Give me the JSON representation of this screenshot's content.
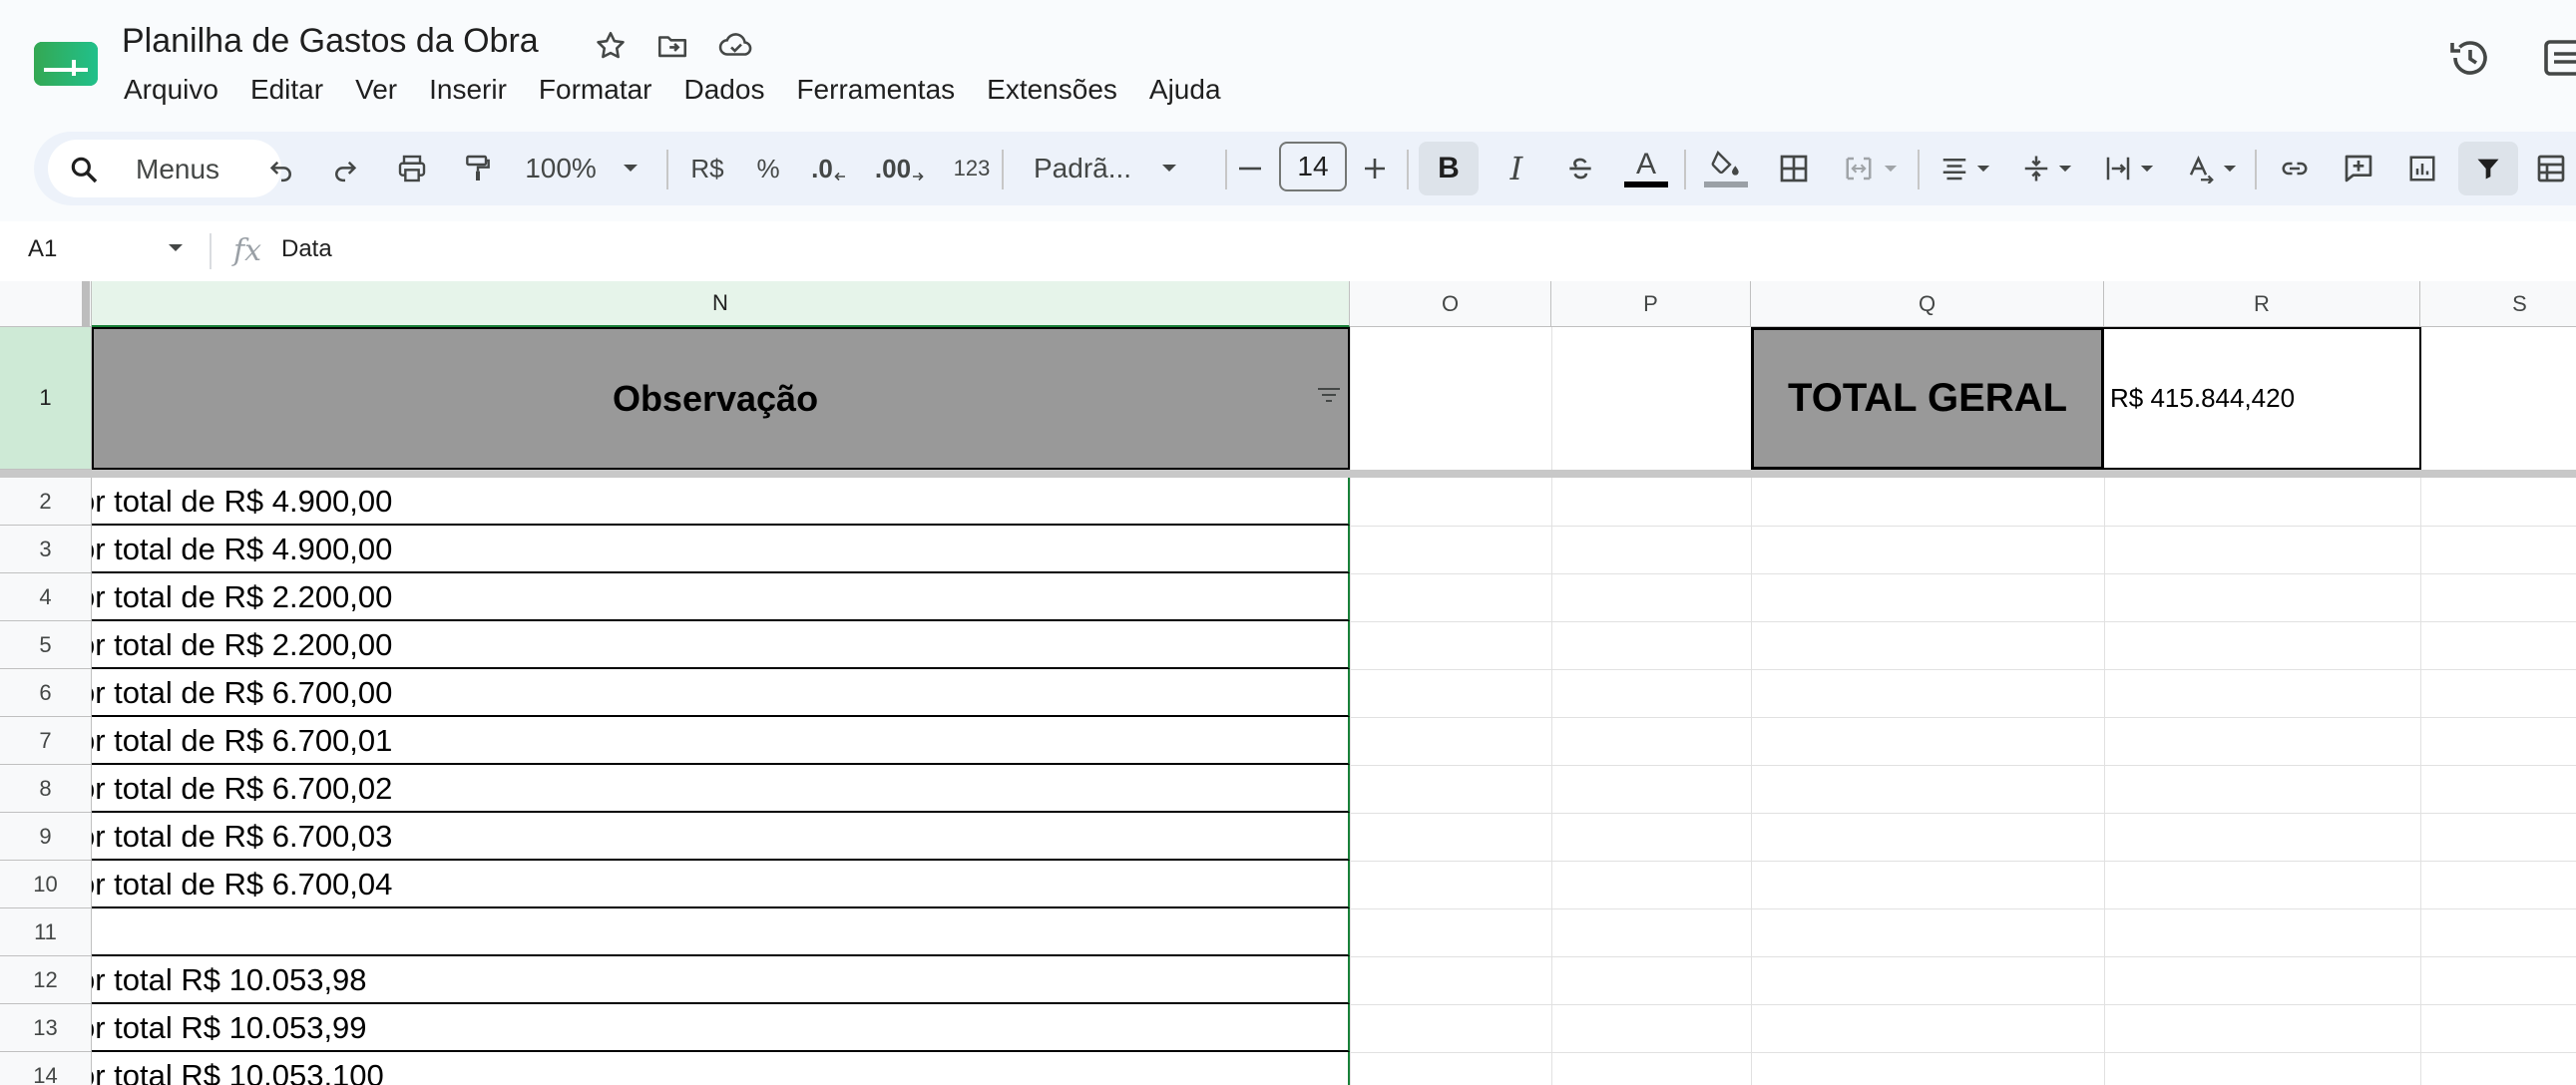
{
  "app": {
    "title": "Planilha de Gastos da Obra",
    "menus": [
      "Arquivo",
      "Editar",
      "Ver",
      "Inserir",
      "Formatar",
      "Dados",
      "Ferramentas",
      "Extensões",
      "Ajuda"
    ]
  },
  "toolbar": {
    "search_label": "Menus",
    "zoom": "100%",
    "currency": "R$",
    "percent": "%",
    "decrease_decimals": ".0",
    "increase_decimals": ".00",
    "number_format": "123",
    "font_name": "Padrã...",
    "font_size": "14",
    "bold": "B",
    "italic": "I",
    "text_color_glyph": "A"
  },
  "formula_bar": {
    "cell_ref": "A1",
    "fx": "fx",
    "formula": "Data"
  },
  "grid": {
    "columns": [
      "N",
      "O",
      "P",
      "Q",
      "R",
      "S"
    ],
    "rows": [
      "1",
      "2",
      "3",
      "4",
      "5",
      "6",
      "7",
      "8",
      "9",
      "10",
      "11",
      "12",
      "13",
      "14"
    ],
    "header_observacao": "Observação",
    "total_label": "TOTAL GERAL",
    "total_value": "R$ 415.844,420",
    "n_values": [
      "or total de R$ 4.900,00",
      "or total de R$ 4.900,00",
      "or total de R$ 2.200,00",
      "or total de R$ 2.200,00",
      "or total de R$ 6.700,00",
      "or total de R$ 6.700,01",
      "or total de R$ 6.700,02",
      "or total de R$ 6.700,03",
      "or total de R$ 6.700,04",
      "",
      "or total R$ 10.053,98",
      "or total R$ 10.053,99",
      "or total R$ 10.053,100"
    ]
  },
  "colors": {
    "header_fill": "#999999",
    "selected_col": "#e6f4ea",
    "selected_row": "#ceead6",
    "accent_green": "#188038",
    "toolbar_bg": "#edf2fa"
  }
}
